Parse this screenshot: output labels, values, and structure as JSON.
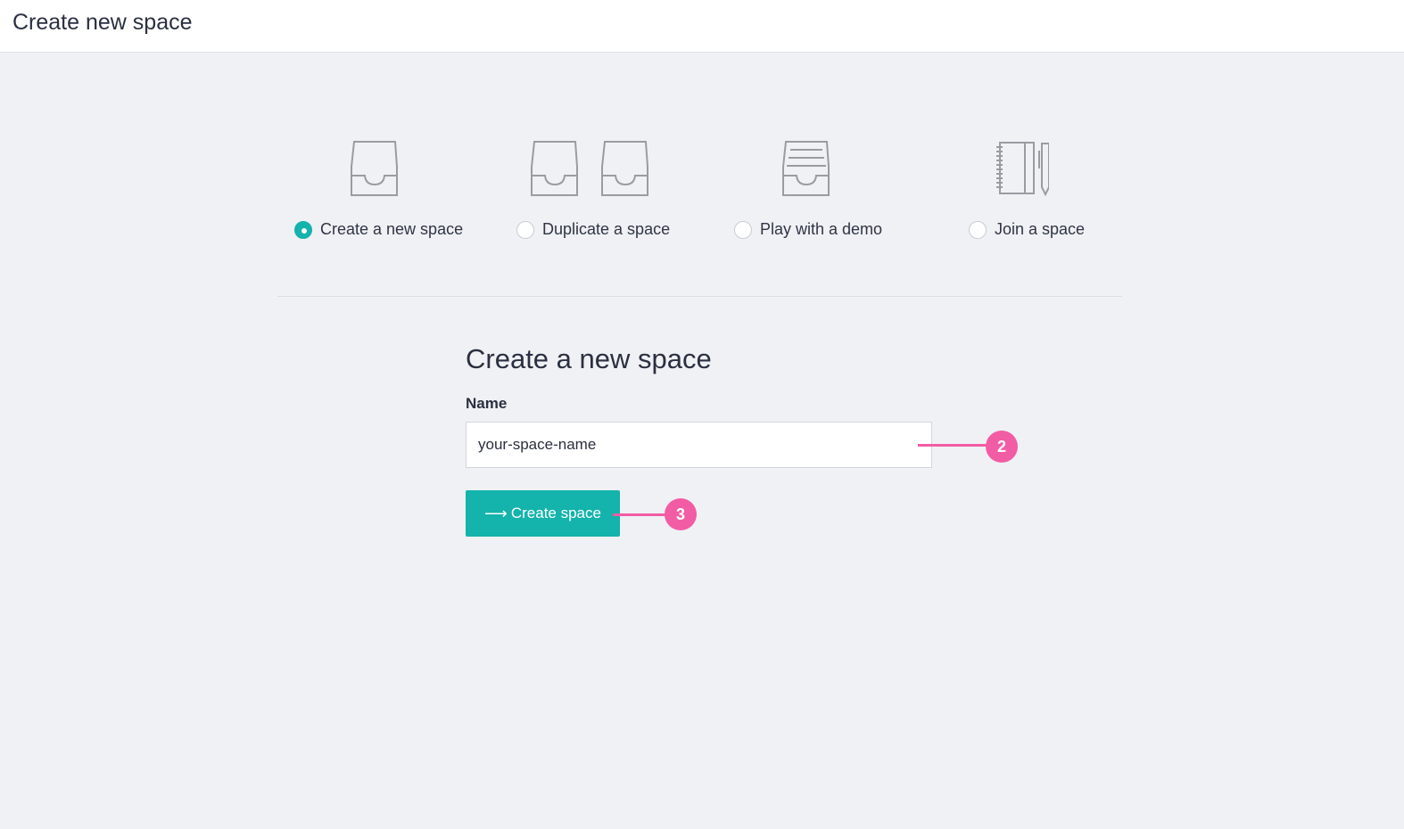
{
  "header": {
    "title": "Create new space"
  },
  "options": [
    {
      "label": "Create a new space",
      "selected": true,
      "icon": "inbox-tray-icon"
    },
    {
      "label": "Duplicate a space",
      "selected": false,
      "icon": "double-inbox-tray-icon"
    },
    {
      "label": "Play with a demo",
      "selected": false,
      "icon": "filled-inbox-tray-icon"
    },
    {
      "label": "Join a space",
      "selected": false,
      "icon": "notebook-pencil-icon"
    }
  ],
  "form": {
    "heading": "Create a new space",
    "name_label": "Name",
    "name_value": "your-space-name",
    "submit_label": "Create space",
    "submit_icon": "arrow-right-icon"
  },
  "callouts": [
    {
      "number": "2",
      "target": "name-input"
    },
    {
      "number": "3",
      "target": "create-space-button"
    }
  ],
  "colors": {
    "accent": "#14b3ab",
    "callout": "#f25ca5",
    "background": "#f0f1f4",
    "icon_stroke": "#9a9ca3"
  }
}
